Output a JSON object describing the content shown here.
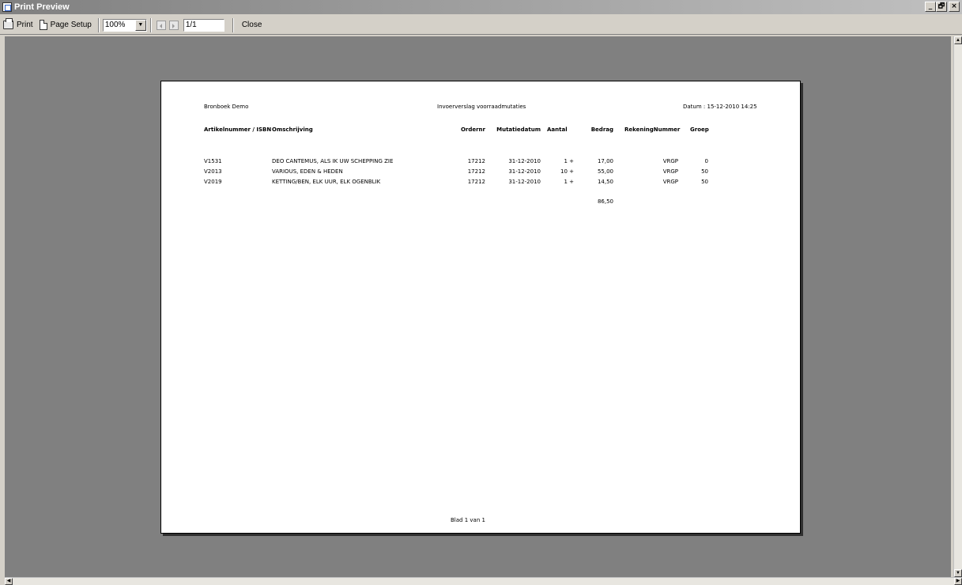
{
  "window": {
    "title": "Print Preview",
    "minimize": "_",
    "restore": "🗗",
    "close": "×"
  },
  "toolbar": {
    "print_label": "Print",
    "page_setup_label": "Page Setup",
    "zoom_value": "100%",
    "page_value": "1/1",
    "close_label": "Close"
  },
  "report": {
    "company": "Bronboek Demo",
    "title": "Invoerverslag voorraadmutaties",
    "date": "Datum : 15-12-2010 14:25",
    "headers": {
      "artikelnummer": "Artikelnummer / ISBN",
      "omschrijving": "Omschrijving",
      "ordernr": "Ordernr",
      "mutatiedatum": "Mutatiedatum",
      "aantal": "Aantal",
      "bedrag": "Bedrag",
      "rekeningnummer": "RekeningNummer",
      "groep": "Groep"
    },
    "rows": [
      {
        "artikel": "V1531",
        "omschrijving": "DEO CANTEMUS, ALS IK UW SCHEPPING ZIE",
        "ordernr": "17212",
        "datum": "31-12-2010",
        "aantal": "1 +",
        "bedrag": "17,00",
        "rekening": "VRGP",
        "groep": "0"
      },
      {
        "artikel": "V2013",
        "omschrijving": "VARIOUS, EDEN & HEDEN",
        "ordernr": "17212",
        "datum": "31-12-2010",
        "aantal": "10 +",
        "bedrag": "55,00",
        "rekening": "VRGP",
        "groep": "50"
      },
      {
        "artikel": "V2019",
        "omschrijving": "KETTING/BEN, ELK UUR, ELK OGENBLIK",
        "ordernr": "17212",
        "datum": "31-12-2010",
        "aantal": "1 +",
        "bedrag": "14,50",
        "rekening": "VRGP",
        "groep": "50"
      }
    ],
    "total": "86,50",
    "footer": "Blad 1 van 1"
  }
}
